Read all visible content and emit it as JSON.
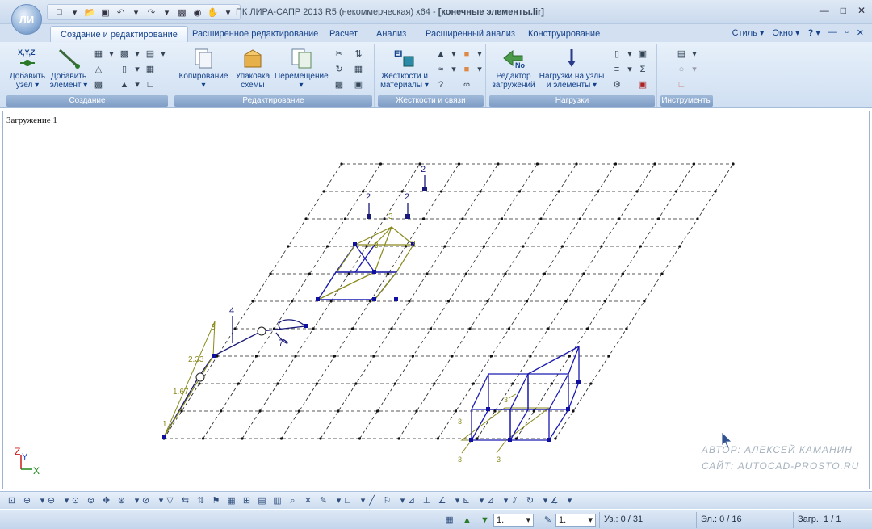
{
  "window": {
    "title_prefix": "ПК ЛИРА-САПР  2013 R5 (некоммерческая) x64 - ",
    "title_file": "[конечные элементы.lir]",
    "app_button": "ЛИ"
  },
  "tabs": [
    "Создание и редактирование",
    "Расширенное редактирование",
    "Расчет",
    "Анализ",
    "Расширенный анализ",
    "Конструирование"
  ],
  "right_menu": {
    "style": "Стиль",
    "window": "Окно",
    "help": "?"
  },
  "ribbon": {
    "create": {
      "label": "Создание",
      "add_node_l1": "Добавить",
      "add_node_l2": "узел",
      "add_elem_l1": "Добавить",
      "add_elem_l2": "элемент",
      "xyz_icon_text": "X,Y,Z"
    },
    "edit": {
      "label": "Редактирование",
      "copy": "Копирование",
      "pack_l1": "Упаковка",
      "pack_l2": "схемы",
      "move": "Перемещение"
    },
    "stiff": {
      "label": "Жесткости и связи",
      "stiff_l1": "Жесткости и",
      "stiff_l2": "материалы"
    },
    "loads": {
      "label": "Нагрузки",
      "editor_l1": "Редактор",
      "editor_l2": "загружений",
      "loads_l1": "Нагрузки на узлы",
      "loads_l2": "и элементы"
    },
    "tools": {
      "label": "Инструменты"
    }
  },
  "work": {
    "load_case": "Загружение 1",
    "axis_z": "Z",
    "axis_y": "Y",
    "axis_x": "X",
    "load_labels": [
      "2",
      "2",
      "2",
      "4"
    ],
    "beam_labels": [
      "3",
      "2.33",
      "1.67",
      "1"
    ],
    "plate_labels": [
      "3",
      "3",
      "3"
    ],
    "solid_labels": [
      "3",
      "3",
      "3",
      "3"
    ],
    "load_value_7": "7"
  },
  "watermark": {
    "author": "АВТОР: АЛЕКСЕЙ КАМАНИН",
    "site": "САЙТ: AUTOCAD-PROSTO.RU"
  },
  "statusbar": {
    "combo1": "1.",
    "combo2": "1.",
    "nodes": "Уз.: 0 / 31",
    "elements": "Эл.: 0 / 16",
    "loads": "Загр.: 1 / 1"
  },
  "colors": {
    "ribbon_blue": "#15428b",
    "mesh": "#222222",
    "frame_blue": "#1a1ab0",
    "element_olive": "#8a8a1e",
    "node_blue": "#1010a0",
    "watermark": "#a6b2bf"
  }
}
